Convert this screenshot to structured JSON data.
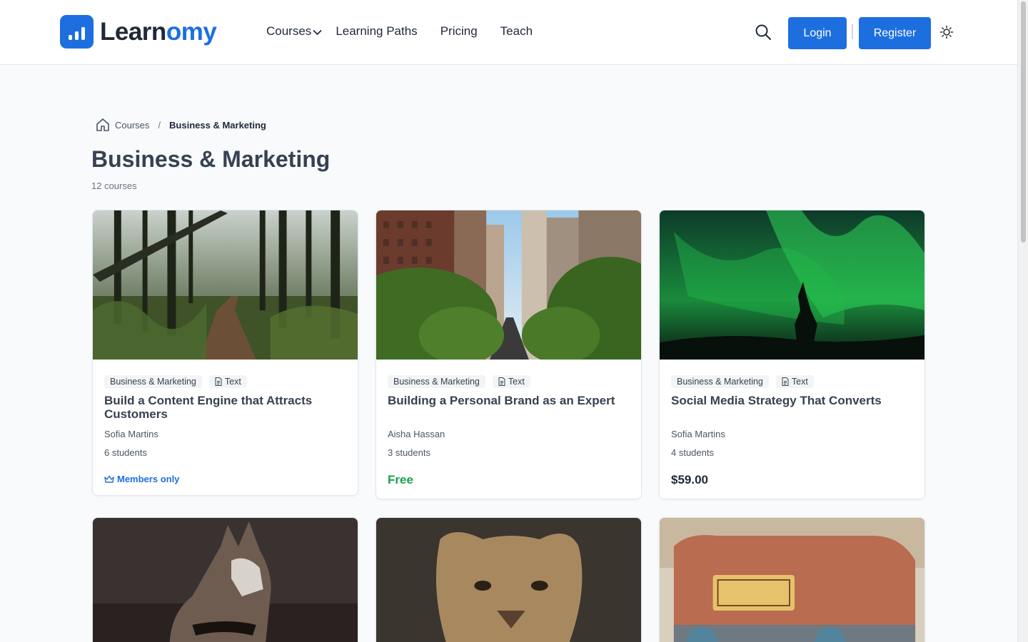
{
  "brand": {
    "name_part1": "Learn",
    "name_part2": "omy"
  },
  "nav": {
    "courses": "Courses",
    "learning_paths": "Learning Paths",
    "pricing": "Pricing",
    "teach": "Teach"
  },
  "header": {
    "login": "Login",
    "register": "Register"
  },
  "breadcrumb": {
    "courses": "Courses",
    "separator": "/",
    "current": "Business & Marketing"
  },
  "page": {
    "title": "Business & Marketing",
    "count": "12 courses"
  },
  "colors": {
    "primary": "#1d6fe0",
    "free": "#16a34a",
    "background": "#f8fafc"
  },
  "courses": [
    {
      "category": "Business & Marketing",
      "type": "Text",
      "title": "Build a Content Engine that Attracts Customers",
      "author": "Sofia Martins",
      "students": "6 students",
      "price": "Members only",
      "price_kind": "members",
      "image": "forest-trail"
    },
    {
      "category": "Business & Marketing",
      "type": "Text",
      "title": "Building a Personal Brand as an Expert",
      "author": "Aisha Hassan",
      "students": "3 students",
      "price": "Free",
      "price_kind": "free",
      "image": "city-street"
    },
    {
      "category": "Business & Marketing",
      "type": "Text",
      "title": "Social Media Strategy That Converts",
      "author": "Sofia Martins",
      "students": "4 students",
      "price": "$59.00",
      "price_kind": "paid",
      "image": "northern-lights"
    },
    {
      "image": "husky-dog"
    },
    {
      "image": "lioness"
    },
    {
      "image": "tuk-tuk"
    }
  ]
}
